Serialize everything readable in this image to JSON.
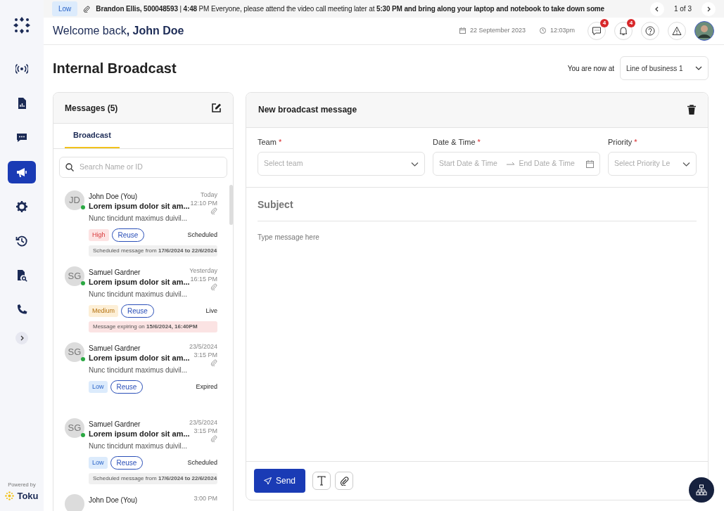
{
  "banner": {
    "priority": {
      "label": "Low",
      "kind": "low"
    },
    "text": "**Brandon Ellis, 500048593** | **4:48** PM Everyone, please attend the video call meeting later at **5:30 PM and bring along your laptop and notebook to take down some**",
    "pager": "1 of 3"
  },
  "header": {
    "greeting": "Welcome back",
    "user": ", John Doe",
    "date": "22 September 2023",
    "time": "12:03pm",
    "chat_badge": "4",
    "bell_badge": "4"
  },
  "sidebar": {
    "items": [
      {
        "selected": false
      },
      {
        "selected": false
      },
      {
        "selected": false
      },
      {
        "selected": true
      },
      {
        "selected": false
      },
      {
        "selected": false
      },
      {
        "selected": false
      },
      {
        "selected": false
      }
    ],
    "powered_by": "Powered by",
    "brand": "Toku"
  },
  "page": {
    "title": "Internal Broadcast",
    "location_label": "You are now at",
    "location": "Line of business 1"
  },
  "messages_panel": {
    "title": "Messages (5)",
    "tabs": [
      {
        "label": "Broadcast",
        "selected": true
      }
    ],
    "search_placeholder": "Search Name or ID",
    "messages": [
      {
        "initials": "JD",
        "online": true,
        "sender": "John Doe (You)",
        "date": "Today",
        "time": "12:10 PM",
        "attachment": true,
        "subject": "Lorem ipsum dolor sit am...",
        "preview": "Nunc tincidunt maximus duivil...",
        "tag": {
          "label": "High",
          "kind": "high"
        },
        "action": "Reuse",
        "status": "Scheduled",
        "note": {
          "kind": "scheduled",
          "text": "Scheduled message from **17/6/2024 to 22/6/2024**"
        }
      },
      {
        "initials": "SG",
        "online": true,
        "sender": "Samuel Gardner",
        "date": "Yesterday",
        "time": "16:15 PM",
        "attachment": true,
        "subject": "Lorem ipsum dolor sit am...",
        "preview": "Nunc tincidunt maximus duivil...",
        "tag": {
          "label": "Medium",
          "kind": "medium"
        },
        "action": "Reuse",
        "status": "Live",
        "note": {
          "kind": "expiring",
          "text": "Message expiring on **15/6/2024, 16:40PM**"
        }
      },
      {
        "initials": "SG",
        "online": true,
        "sender": "Samuel Gardner",
        "date": "23/5/2024",
        "time": "3:15 PM",
        "attachment": true,
        "subject": "Lorem ipsum dolor sit am...",
        "preview": "Nunc tincidunt maximus duivil...",
        "tag": {
          "label": "Low",
          "kind": "low"
        },
        "action": "Reuse",
        "status": "Expired"
      },
      {
        "initials": "SG",
        "online": true,
        "sender": "Samuel Gardner",
        "date": "23/5/2024",
        "time": "3:15 PM",
        "attachment": true,
        "subject": "Lorem ipsum dolor sit am...",
        "preview": "Nunc tincidunt maximus duivil...",
        "tag": {
          "label": "Low",
          "kind": "low"
        },
        "action": "Reuse",
        "status": "Scheduled",
        "note": {
          "kind": "scheduled",
          "text": "Scheduled message from **17/6/2024 to 22/6/2024**"
        }
      },
      {
        "sender": "John Doe (You)",
        "time": "3:00 PM"
      }
    ]
  },
  "compose": {
    "title": "New broadcast message",
    "fields": [
      {
        "kind": "select",
        "label": "Team",
        "required_mark": "*",
        "placeholder": "Select team"
      },
      {
        "kind": "range",
        "label": "Date & Time",
        "required_mark": "*",
        "placeholder": "Start Date & Time",
        "placeholder_end": "End Date & Time"
      },
      {
        "kind": "select",
        "label": "Priority",
        "required_mark": "*",
        "placeholder": "Select Priority Le"
      }
    ],
    "subject_placeholder": "Subject",
    "body_placeholder": "Type message here",
    "send": "Send"
  }
}
